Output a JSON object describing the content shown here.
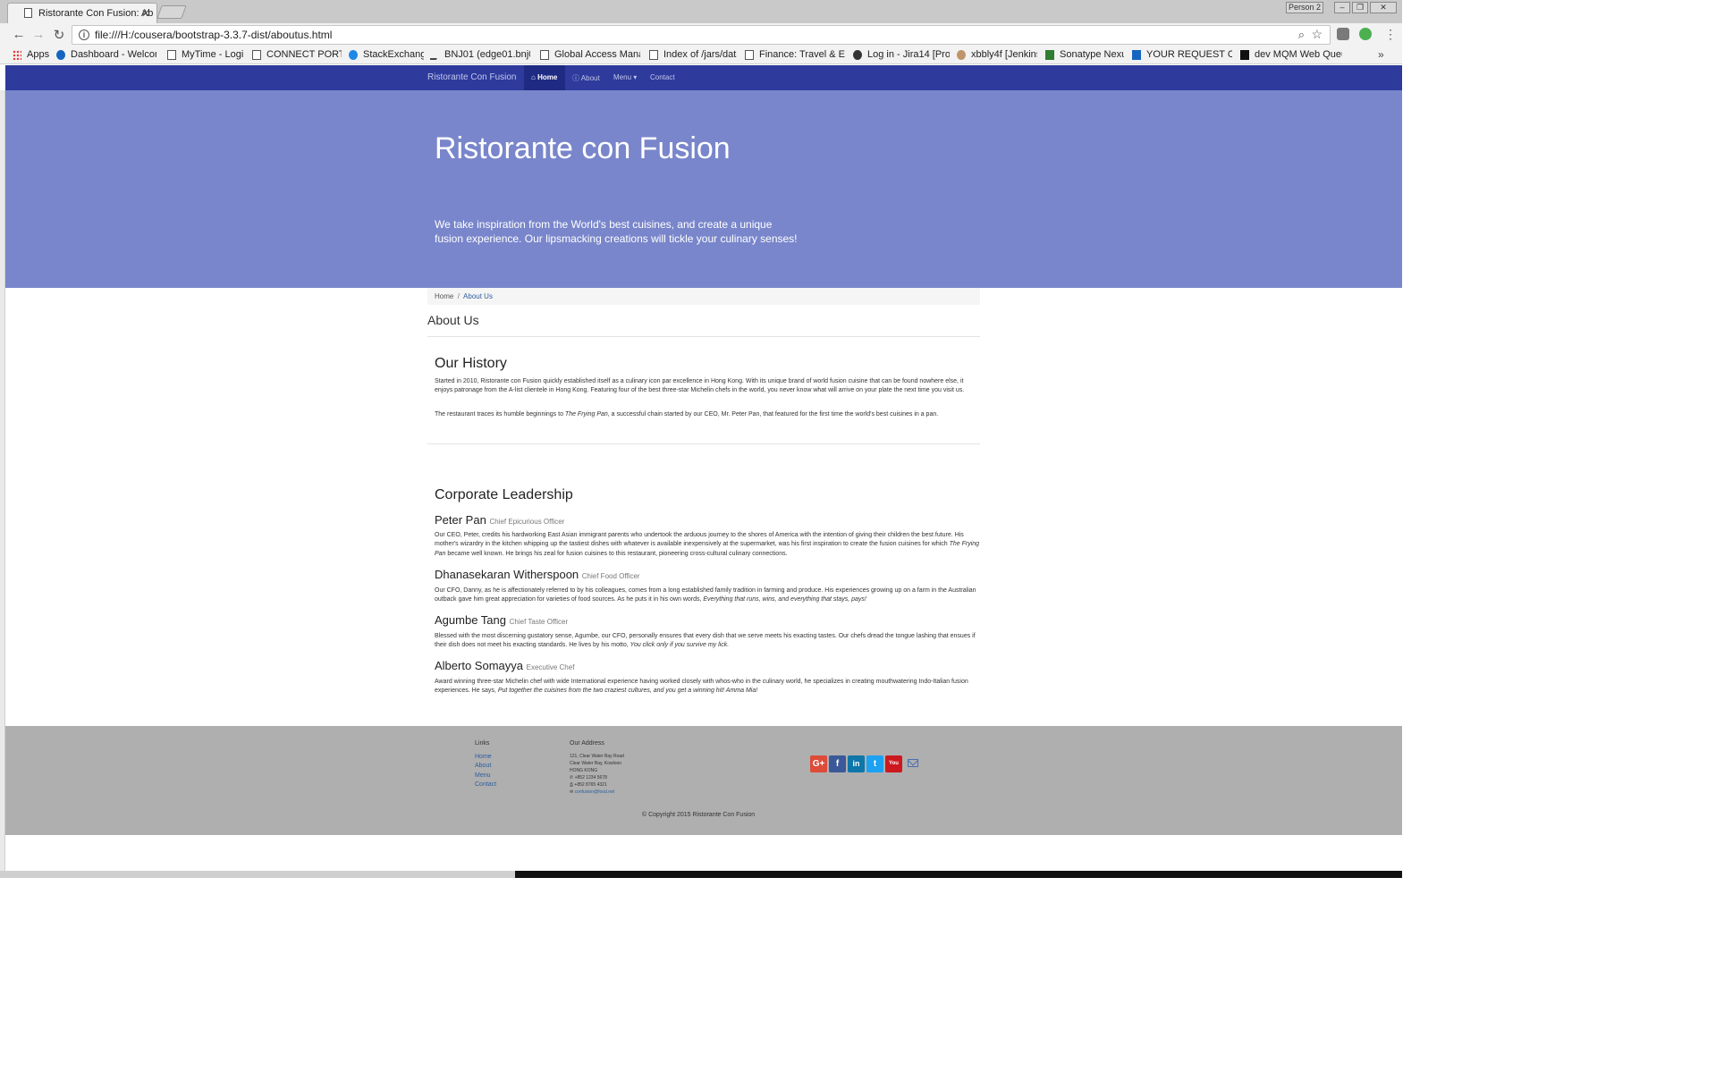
{
  "browser": {
    "tab_title": "Ristorante Con Fusion: Ab",
    "person": "Person 2",
    "url": "file:///H:/cousera/bootstrap-3.3.7-dist/aboutus.html",
    "bookmarks": [
      "Apps",
      "Dashboard - Welcome",
      "MyTime - Login",
      "CONNECT PORTAL",
      "StackExchange",
      "BNJ01 (edge01.bnj01.",
      "Global Access Manag",
      "Index of /jars/data",
      "Finance: Travel & Exp",
      "Log in - Jira14 [Prod]",
      "xbbly4f [Jenkins]",
      "Sonatype Nexus",
      "YOUR REQUEST COU",
      "dev MQM Web Queue"
    ]
  },
  "navbar": {
    "brand": "Ristorante Con Fusion",
    "items": [
      "Home",
      "About",
      "Menu",
      "Contact"
    ]
  },
  "jumbotron": {
    "title": "Ristorante con Fusion",
    "text": "We take inspiration from the World's best cuisines, and create a unique fusion experience. Our lipsmacking creations will tickle your culinary senses!"
  },
  "breadcrumb": [
    "Home",
    "About Us"
  ],
  "page_heading": "About Us",
  "history": {
    "heading": "Our History",
    "p1": "Started in 2010, Ristorante con Fusion quickly established itself as a culinary icon par excellence in Hong Kong. With its unique brand of world fusion cuisine that can be found nowhere else, it enjoys patronage from the A-list clientele in Hong Kong. Featuring four of the best three-star Michelin chefs in the world, you never know what will arrive on your plate the next time you visit us.",
    "p2_before": "The restaurant traces its humble beginnings to ",
    "p2_em": "The Frying Pan",
    "p2_after": ", a successful chain started by our CEO, Mr. Peter Pan, that featured for the first time the world's best cuisines in a pan."
  },
  "leadership": {
    "heading": "Corporate Leadership",
    "people": [
      {
        "name": "Peter Pan",
        "title": "Chief Epicurious Officer",
        "before": "Our CEO, Peter, credits his hardworking East Asian immigrant parents who undertook the arduous journey to the shores of America with the intention of giving their children the best future. His mother's wizardry in the kitchen whipping up the tastiest dishes with whatever is available inexpensively at the supermarket, was his first inspiration to create the fusion cuisines for which ",
        "em": "The Frying Pan",
        "after": " became well known. He brings his zeal for fusion cuisines to this restaurant, pioneering cross-cultural culinary connections."
      },
      {
        "name": "Dhanasekaran Witherspoon",
        "title": "Chief Food Officer",
        "before": "Our CFO, Danny, as he is affectionately referred to by his colleagues, comes from a long established family tradition in farming and produce. His experiences growing up on a farm in the Australian outback gave him great appreciation for varieties of food sources. As he puts it in his own words, ",
        "em": "Everything that runs, wins, and everything that stays, pays!",
        "after": ""
      },
      {
        "name": "Agumbe Tang",
        "title": "Chief Taste Officer",
        "before": "Blessed with the most discerning gustatory sense, Agumbe, our CFO, personally ensures that every dish that we serve meets his exacting tastes. Our chefs dread the tongue lashing that ensues if their dish does not meet his exacting standards. He lives by his motto, ",
        "em": "You click only if you survive my lick.",
        "after": ""
      },
      {
        "name": "Alberto Somayya",
        "title": "Executive Chef",
        "before": "Award winning three-star Michelin chef with wide International experience having worked closely with whos-who in the culinary world, he specializes in creating mouthwatering Indo-Italian fusion experiences. He says, ",
        "em": "Put together the cuisines from the two craziest cultures, and you get a winning hit! Amma Mia!",
        "after": ""
      }
    ]
  },
  "footer": {
    "links_heading": "Links",
    "links": [
      "Home",
      "About",
      "Menu",
      "Contact"
    ],
    "address_heading": "Our Address",
    "address": [
      "121, Clear Water Bay Road",
      "Clear Water Bay, Kowloon",
      "HONG KONG"
    ],
    "phone": "+852 1234 5678",
    "fax": "+852 8765 4321",
    "email": "confusion@food.net",
    "social": [
      "G+",
      "f",
      "in",
      "t",
      "You"
    ],
    "copyright": "© Copyright 2015 Ristorante Con Fusion"
  }
}
